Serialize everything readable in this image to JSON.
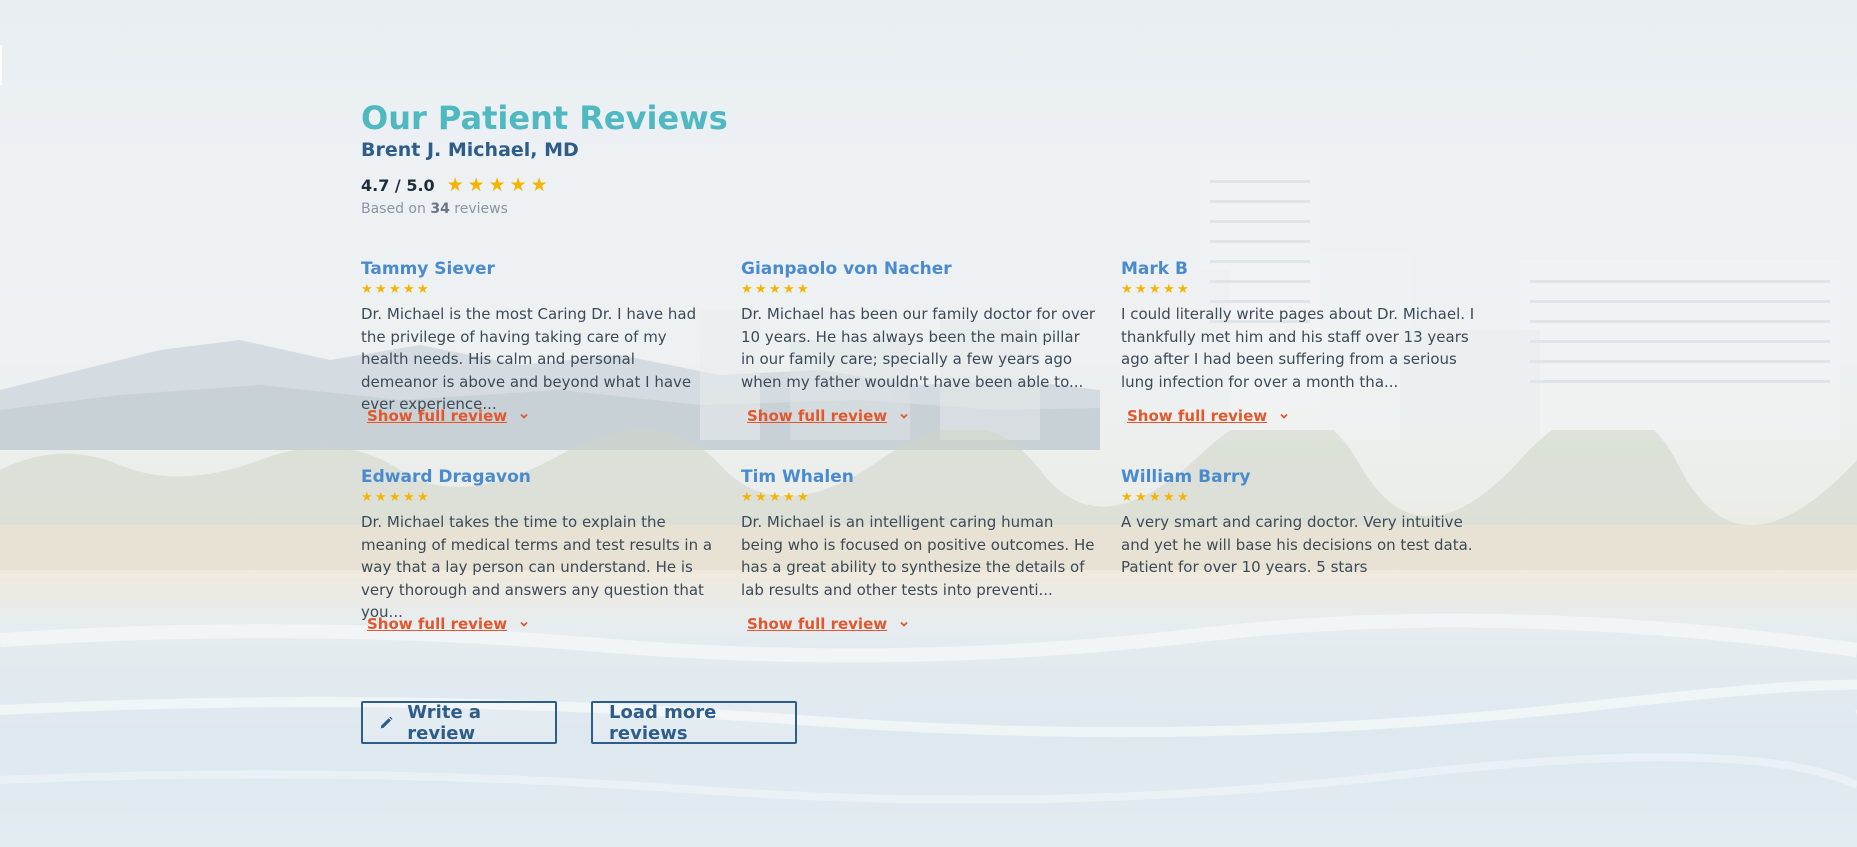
{
  "section": {
    "title": "Our Patient Reviews",
    "doctor_name": "Brent J. Michael, MD",
    "rating_value": "4.7 / 5.0",
    "rating_stars": 5,
    "based_on_prefix": "Based on",
    "based_on_count": "34",
    "based_on_suffix": "reviews"
  },
  "reviews": [
    {
      "name": "Tammy Siever",
      "stars": 5,
      "text": "Dr. Michael is the most Caring Dr. I have had the privilege of having taking care of my health needs. His calm and personal demeanor is above and beyond what I have ever experience...",
      "toggle_label": "Show full review"
    },
    {
      "name": "Gianpaolo von Nacher",
      "stars": 5,
      "text": "Dr. Michael has been our family doctor for over 10 years. He has always been the main pillar in our family care; specially a few years ago when my father wouldn't have been able to...",
      "toggle_label": "Show full review"
    },
    {
      "name": "Mark B",
      "stars": 5,
      "text": "I could literally write pages about Dr. Michael. I thankfully met him and his staff over 13 years ago after I had been suffering from a serious lung infection for over a month tha...",
      "toggle_label": "Show full review"
    },
    {
      "name": "Edward Dragavon",
      "stars": 5,
      "text": "Dr. Michael takes the time to explain the meaning of medical terms and test results in a way that a lay person can understand. He is very thorough and answers any question that you...",
      "toggle_label": "Show full review"
    },
    {
      "name": "Tim Whalen",
      "stars": 5,
      "text": "Dr. Michael is an intelligent caring human being who is focused on positive outcomes. He has a great ability to synthesize the details of lab results and other tests into preventi...",
      "toggle_label": "Show full review"
    },
    {
      "name": "William Barry",
      "stars": 5,
      "text": "A very smart and caring doctor. Very intuitive and yet he will base his decisions on test data. Patient for over 10 years. 5 stars",
      "toggle_label": ""
    }
  ],
  "buttons": {
    "write_review": "Write a review",
    "load_more": "Load more reviews"
  },
  "colors": {
    "title": "#4fb8c1",
    "doctor": "#2f5d8a",
    "reviewer": "#4a8bd0",
    "link": "#e2572c",
    "star": "#f4b400"
  },
  "icons": {
    "star": "star-icon",
    "chevron": "chevron-down-icon",
    "pencil": "pencil-icon"
  }
}
